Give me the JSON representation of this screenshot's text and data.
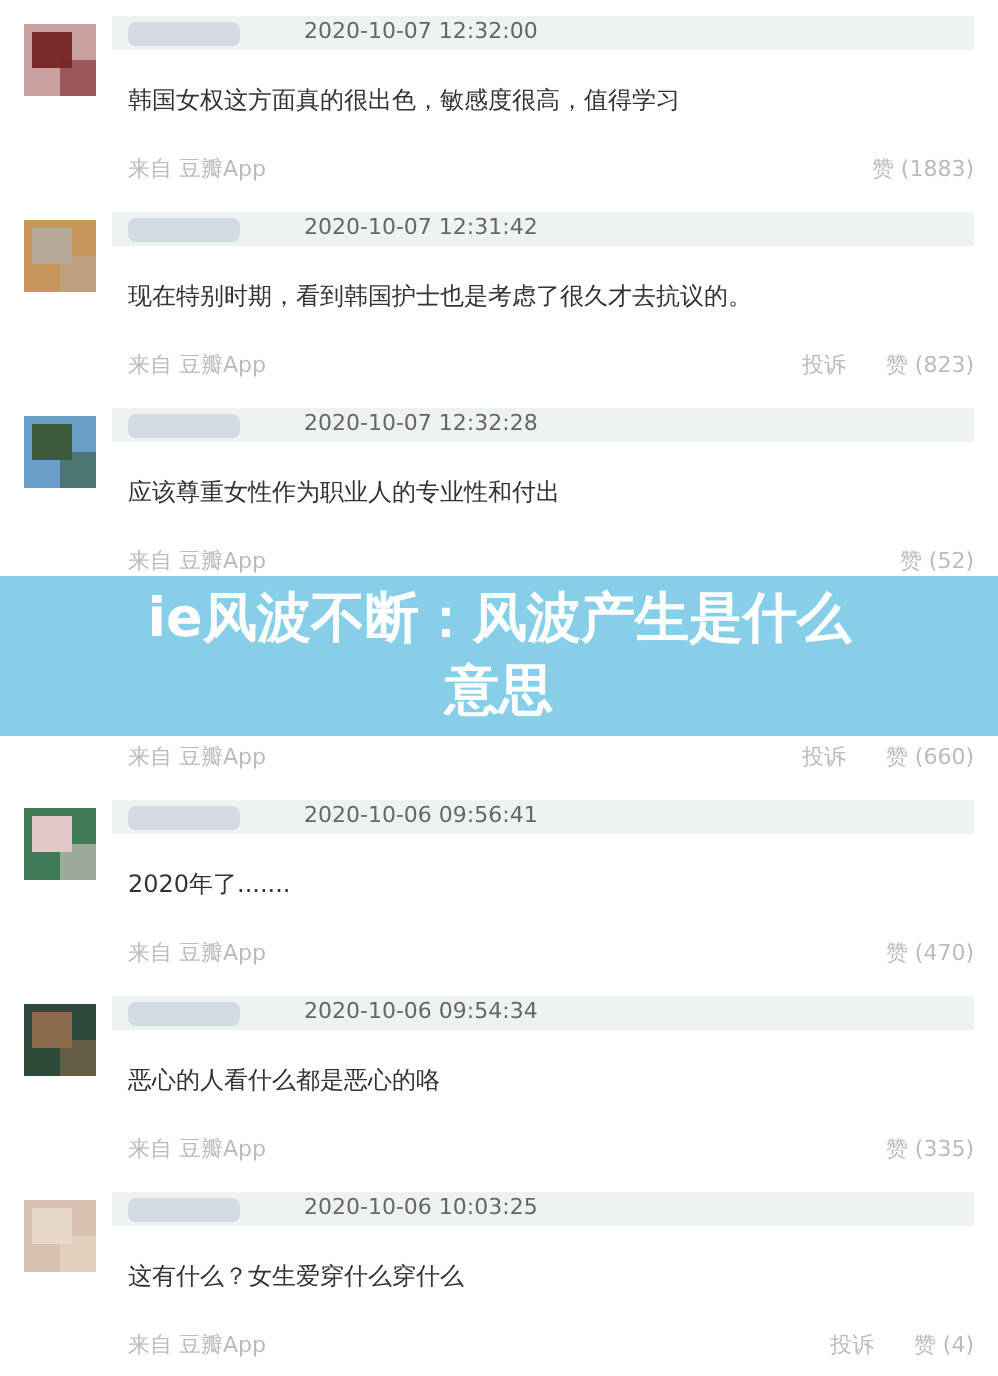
{
  "comments": [
    {
      "time": "2020-10-07 12:32:00",
      "text": "韩国女权这方面真的很出色，敏感度很高，值得学习",
      "source": "来自 豆瓣App",
      "likes": "赞 (1883)"
    },
    {
      "time": "2020-10-07 12:31:42",
      "text": "现在特别时期，看到韩国护士也是考虑了很久才去抗议的。",
      "source": "来自 豆瓣App",
      "report": "投诉",
      "likes": "赞 (823)"
    },
    {
      "time": "2020-10-07 12:32:28",
      "text": "应该尊重女性作为职业人的专业性和付出",
      "source": "来自 豆瓣App",
      "likes": "赞 (52)"
    },
    {
      "source": "来自 豆瓣App",
      "report": "投诉",
      "likes": "赞 (660)"
    },
    {
      "time": "2020-10-06 09:56:41",
      "text": "2020年了.......",
      "source": "来自 豆瓣App",
      "likes": "赞 (470)"
    },
    {
      "time": "2020-10-06 09:54:34",
      "text": "恶心的人看什么都是恶心的咯",
      "source": "来自 豆瓣App",
      "likes": "赞 (335)"
    },
    {
      "time": "2020-10-06 10:03:25",
      "text": "这有什么？女生爱穿什么穿什么",
      "source": "来自 豆瓣App",
      "report": "投诉",
      "likes": "赞 (4)"
    }
  ],
  "banner": {
    "title": "ie风波不断：风波产生是什么意思"
  }
}
